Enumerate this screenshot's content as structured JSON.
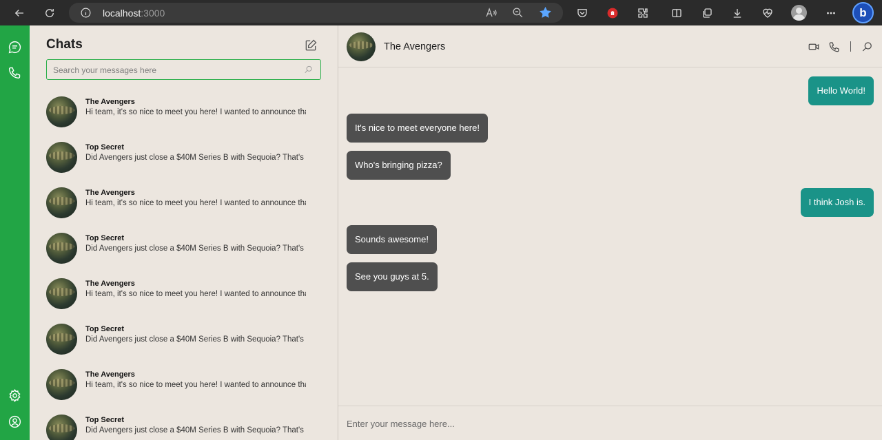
{
  "browser": {
    "host": "localhost",
    "port": ":3000",
    "icons": [
      "back-icon",
      "refresh-icon",
      "info-icon",
      "read-aloud-icon",
      "zoom-icon",
      "favorite-star-icon",
      "pocket-icon",
      "extension-red-icon",
      "puzzle-icon",
      "split-screen-icon",
      "collections-icon",
      "download-icon",
      "heart-pulse-icon",
      "profile-icon",
      "more-icon",
      "bing-icon"
    ],
    "bing_label": "b"
  },
  "rail": {
    "accent": "#22a545",
    "top_icons": [
      "chat-bubble-icon",
      "phone-icon"
    ],
    "bottom_icons": [
      "settings-gear-icon",
      "user-circle-icon"
    ]
  },
  "sidebar": {
    "title": "Chats",
    "search_placeholder": "Search your messages here",
    "chats": [
      {
        "name": "The Avengers",
        "preview": "Hi team, it's so nice to meet you here! I wanted to announce that"
      },
      {
        "name": "Top Secret",
        "preview": "Did Avengers just close a $40M Series B with Sequoia? That's do"
      },
      {
        "name": "The Avengers",
        "preview": "Hi team, it's so nice to meet you here! I wanted to announce that"
      },
      {
        "name": "Top Secret",
        "preview": "Did Avengers just close a $40M Series B with Sequoia? That's do"
      },
      {
        "name": "The Avengers",
        "preview": "Hi team, it's so nice to meet you here! I wanted to announce that"
      },
      {
        "name": "Top Secret",
        "preview": "Did Avengers just close a $40M Series B with Sequoia? That's do"
      },
      {
        "name": "The Avengers",
        "preview": "Hi team, it's so nice to meet you here! I wanted to announce that"
      },
      {
        "name": "Top Secret",
        "preview": "Did Avengers just close a $40M Series B with Sequoia? That's do"
      }
    ]
  },
  "conversation": {
    "title": "The Avengers",
    "header_icons": [
      "video-call-icon",
      "phone-call-icon",
      "search-icon"
    ],
    "messages": [
      {
        "text": "Hello World!",
        "direction": "outgoing"
      },
      {
        "text": "It's nice to meet everyone here!",
        "direction": "incoming"
      },
      {
        "text": "Who's bringing pizza?",
        "direction": "incoming"
      },
      {
        "text": "I think Josh is.",
        "direction": "outgoing"
      },
      {
        "text": "Sounds awesome!",
        "direction": "incoming"
      },
      {
        "text": "See you guys at 5.",
        "direction": "incoming"
      }
    ],
    "outgoing_color": "#1a9388",
    "incoming_color": "#4f4f4f",
    "composer_placeholder": "Enter your message here..."
  }
}
